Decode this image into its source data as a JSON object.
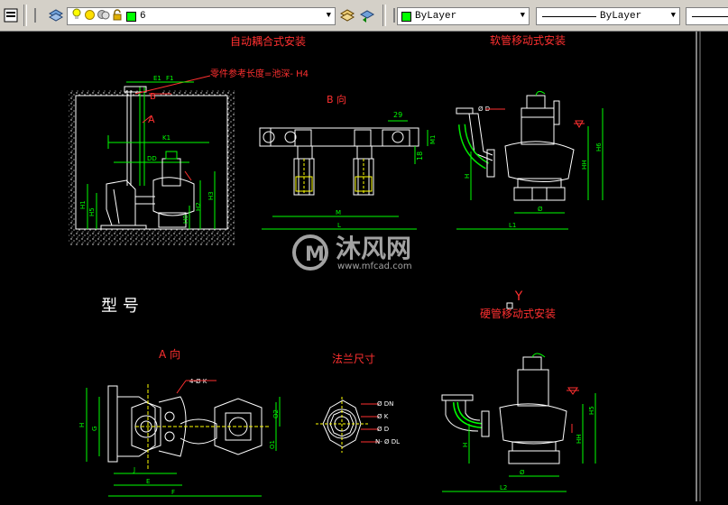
{
  "toolbar": {
    "layer_value": "6",
    "color_value": "ByLayer",
    "linetype_value": "ByLayer",
    "lineweight_value": "",
    "accent_green": "#00ff00",
    "icons": [
      "layer-properties-icon",
      "layer-state-icon",
      "on-off-bulb-icon",
      "freeze-sun-icon",
      "viewport-freeze-icon",
      "lock-icon",
      "color-swatch-icon",
      "make-current-layer-icon",
      "layer-previous-icon"
    ]
  },
  "drawing": {
    "titles": {
      "auto_coupling": "自动耦合式安装",
      "soft_pipe": "软管移动式安装",
      "hard_pipe": "硬管移动式安装",
      "view_b": "B  向",
      "view_a": "A  向",
      "flange": "法兰尺寸",
      "model": "型  号",
      "y_mark": "Y",
      "part_length": "零件参考长度=池深-  H4"
    },
    "dims": {
      "e1": "E1",
      "f1": "F1",
      "b": "B",
      "a": "A",
      "k1": "K1",
      "dd": "DD",
      "h1": "H1",
      "h2": "H2",
      "h3": "H3",
      "h0": "H0",
      "h5": "H5",
      "m": "M",
      "l": "L",
      "m1": "M1",
      "val_29": "29",
      "val_18": "18",
      "phi_d": "Ø D",
      "h6": "H6",
      "hh": "HH",
      "h": "H",
      "l1": "L1",
      "l2": "L2",
      "phi": "Ø",
      "g": "G",
      "o1": "O1",
      "o2": "O2",
      "j": "J",
      "e": "E",
      "f": "F",
      "four_k": "4-Ø K",
      "dn": "Ø DN",
      "k": "Ø K",
      "d": "Ø D",
      "n_dl": "N- Ø DL"
    },
    "watermark": {
      "brand": "沐风网",
      "url": "www.mfcad.com"
    }
  }
}
